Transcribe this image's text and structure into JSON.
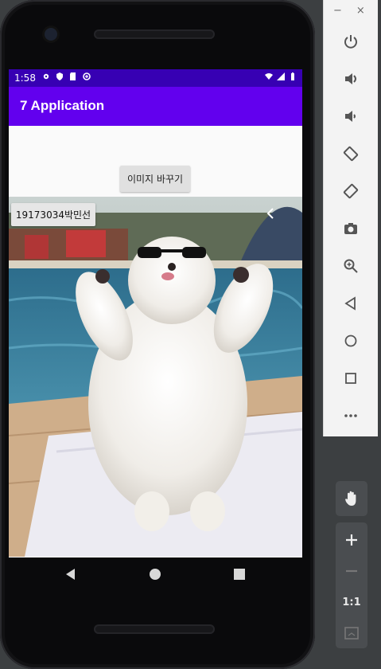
{
  "status_bar": {
    "time": "1:58"
  },
  "app_bar": {
    "title": "7 Application"
  },
  "buttons": {
    "change_image": "이미지 바꾸기",
    "student_name": "19173034박민선"
  },
  "photo": {
    "description_icon": "dog-photo"
  },
  "emulator_panel": {
    "tools": [
      "power-icon",
      "volume-up-icon",
      "volume-down-icon",
      "rotate-left-icon",
      "rotate-right-icon",
      "camera-icon",
      "zoom-icon",
      "back-icon",
      "home-icon",
      "overview-icon",
      "more-icon"
    ],
    "zoom_ratio": "1:1"
  },
  "colors": {
    "status_bar": "#3700b3",
    "app_bar": "#6200ee"
  }
}
